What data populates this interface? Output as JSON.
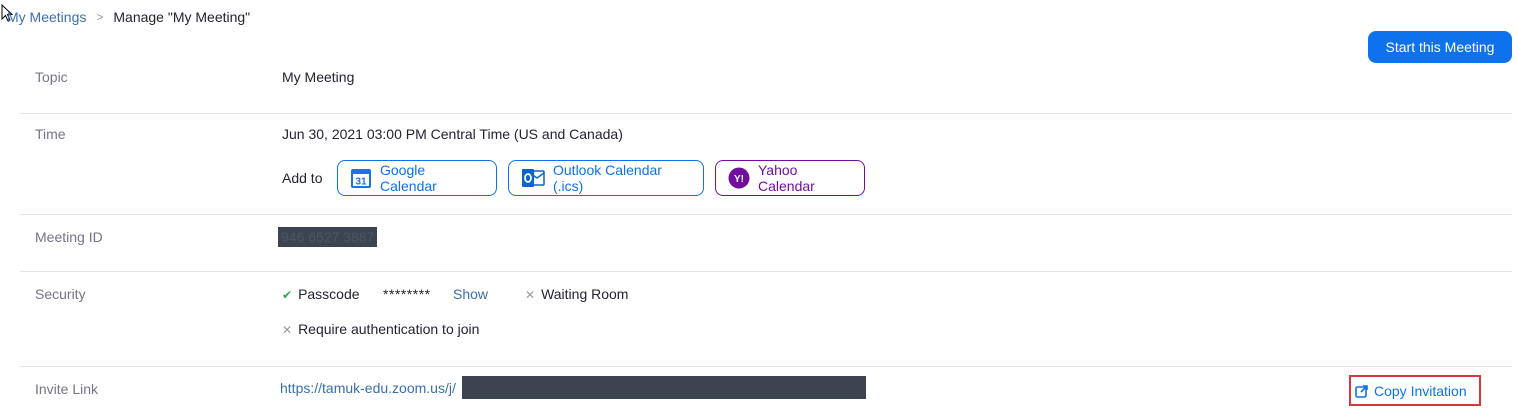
{
  "breadcrumb": {
    "parent": "My Meetings",
    "separator": ">",
    "current": "Manage \"My Meeting\""
  },
  "start_button": "Start this Meeting",
  "rows": {
    "topic": {
      "label": "Topic",
      "value": "My Meeting"
    },
    "time": {
      "label": "Time",
      "value": "Jun 30, 2021 03:00 PM Central Time (US and Canada)",
      "add_to": "Add to",
      "google": "Google Calendar",
      "google_icon_text": "31",
      "outlook": "Outlook Calendar (.ics)",
      "yahoo": "Yahoo Calendar",
      "yahoo_icon_text": "Y!"
    },
    "meeting_id": {
      "label": "Meeting ID",
      "value": "946 6527 3887"
    },
    "security": {
      "label": "Security",
      "passcode": "Passcode",
      "passcode_mask": "********",
      "show": "Show",
      "waiting_room": "Waiting Room",
      "require_auth": "Require authentication to join"
    },
    "invite_link": {
      "label": "Invite Link",
      "prefix": "https://tamuk-edu.zoom.us/j/",
      "copy": "Copy Invitation"
    }
  },
  "colors": {
    "primary": "#0e72ed",
    "yahoo": "#720e9e",
    "check": "#2aa84a",
    "highlight": "#d9373b"
  }
}
